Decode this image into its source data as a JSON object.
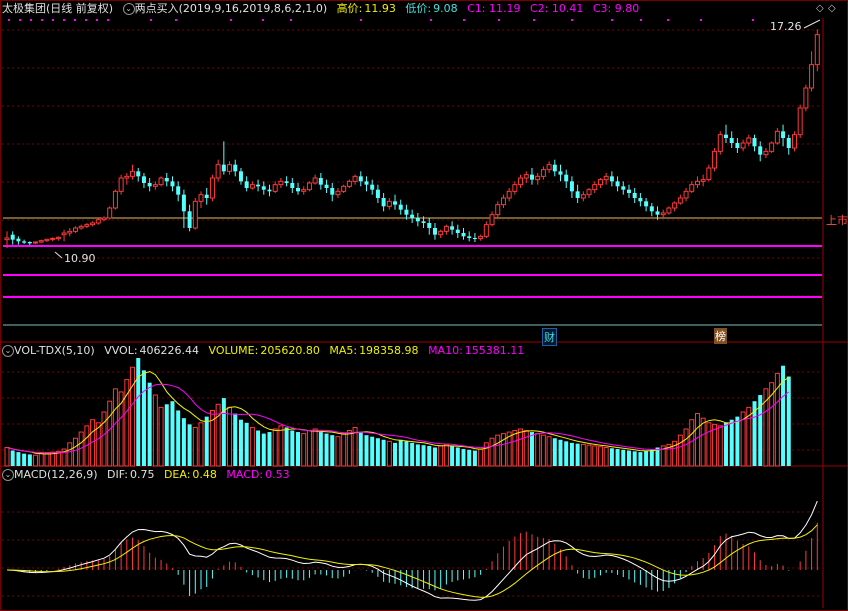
{
  "main": {
    "stock_name": "太极集团",
    "period_label": "(日线 前复权)",
    "indicator_name": "两点买入",
    "indicator_params": "(2019,9,16,2019,8,6,2,1,0)",
    "high_label": "高价:",
    "high_value": "11.93",
    "low_label": "低价:",
    "low_value": "9.08",
    "c1": "C1: 11.19",
    "c2": "C2: 10.41",
    "c3": "C3: 9.80",
    "max_price_label": "17.26",
    "min_price_label": "10.90",
    "right_edge_label": "上市",
    "event_tags": [
      "财",
      "榜"
    ]
  },
  "volume": {
    "name": "VOL-TDX(5,10)",
    "vvol_label": "VVOL:",
    "vvol_value": "406226.44",
    "volume_label": "VOLUME:",
    "volume_value": "205620.80",
    "ma5_label": "MA5:",
    "ma5_value": "198358.98",
    "ma10_label": "MA10:",
    "ma10_value": "155381.11"
  },
  "macd": {
    "name": "MACD(12,26,9)",
    "dif_label": "DIF:",
    "dif_value": "0.75",
    "dea_label": "DEA:",
    "dea_value": "0.48",
    "macd_label": "MACD:",
    "macd_value": "0.53"
  },
  "colors": {
    "up": "#ff3a3a",
    "down": "#54ffff",
    "grid": "#7a0000",
    "yellow": "#f0f000",
    "magenta": "#ff00ff",
    "white": "#ffffff"
  },
  "chart_data": {
    "type": "candlestick",
    "candles": [
      [
        10.95,
        11.2,
        11.0,
        10.7
      ],
      [
        11.1,
        11.2,
        10.95,
        10.8
      ],
      [
        10.98,
        11.05,
        10.9,
        10.8
      ],
      [
        10.9,
        10.95,
        10.86,
        10.82
      ],
      [
        10.88,
        10.9,
        10.84,
        10.78
      ],
      [
        10.86,
        10.9,
        10.88,
        10.82
      ],
      [
        10.88,
        10.95,
        10.92,
        10.85
      ],
      [
        10.92,
        10.98,
        10.96,
        10.88
      ],
      [
        10.96,
        11.02,
        10.99,
        10.9
      ],
      [
        10.98,
        11.05,
        11.02,
        10.92
      ],
      [
        11.1,
        11.25,
        11.15,
        10.9
      ],
      [
        11.15,
        11.3,
        11.2,
        11.05
      ],
      [
        11.2,
        11.35,
        11.3,
        11.15
      ],
      [
        11.3,
        11.4,
        11.35,
        11.25
      ],
      [
        11.35,
        11.45,
        11.4,
        11.3
      ],
      [
        11.4,
        11.5,
        11.45,
        11.35
      ],
      [
        11.45,
        11.6,
        11.55,
        11.4
      ],
      [
        11.55,
        11.65,
        11.6,
        11.5
      ],
      [
        11.6,
        11.95,
        11.9,
        11.55
      ],
      [
        11.9,
        12.45,
        12.4,
        11.85
      ],
      [
        12.4,
        12.9,
        12.8,
        12.3
      ],
      [
        12.8,
        12.95,
        12.85,
        12.6
      ],
      [
        12.85,
        13.2,
        13.0,
        12.75
      ],
      [
        13.0,
        13.1,
        12.85,
        12.7
      ],
      [
        12.85,
        12.95,
        12.65,
        12.5
      ],
      [
        12.65,
        12.8,
        12.55,
        12.4
      ],
      [
        12.55,
        12.7,
        12.6,
        12.45
      ],
      [
        12.6,
        12.85,
        12.8,
        12.55
      ],
      [
        12.8,
        12.95,
        12.7,
        12.55
      ],
      [
        12.7,
        12.85,
        12.55,
        12.4
      ],
      [
        12.55,
        12.7,
        12.3,
        12.1
      ],
      [
        12.3,
        12.45,
        11.8,
        11.3
      ],
      [
        11.8,
        12.0,
        11.3,
        11.2
      ],
      [
        11.3,
        12.2,
        12.1,
        11.25
      ],
      [
        12.1,
        12.4,
        12.3,
        11.9
      ],
      [
        12.3,
        12.5,
        12.2,
        12.0
      ],
      [
        12.2,
        12.9,
        12.8,
        12.1
      ],
      [
        12.8,
        13.35,
        13.2,
        12.7
      ],
      [
        13.2,
        13.9,
        13.0,
        12.9
      ],
      [
        13.0,
        13.3,
        13.2,
        12.9
      ],
      [
        13.2,
        13.35,
        13.0,
        12.85
      ],
      [
        13.0,
        13.1,
        12.7,
        12.6
      ],
      [
        12.7,
        12.85,
        12.5,
        12.4
      ],
      [
        12.5,
        12.7,
        12.6,
        12.45
      ],
      [
        12.6,
        12.75,
        12.55,
        12.4
      ],
      [
        12.55,
        12.7,
        12.45,
        12.3
      ],
      [
        12.45,
        12.6,
        12.4,
        12.25
      ],
      [
        12.4,
        12.7,
        12.6,
        12.35
      ],
      [
        12.6,
        12.8,
        12.7,
        12.5
      ],
      [
        12.7,
        12.85,
        12.65,
        12.55
      ],
      [
        12.65,
        12.8,
        12.5,
        12.35
      ],
      [
        12.5,
        12.65,
        12.4,
        12.3
      ],
      [
        12.4,
        12.55,
        12.45,
        12.3
      ],
      [
        12.45,
        12.7,
        12.65,
        12.4
      ],
      [
        12.65,
        12.9,
        12.8,
        12.6
      ],
      [
        12.8,
        12.95,
        12.6,
        12.45
      ],
      [
        12.6,
        12.75,
        12.5,
        12.35
      ],
      [
        12.5,
        12.65,
        12.3,
        12.1
      ],
      [
        12.3,
        12.5,
        12.4,
        12.2
      ],
      [
        12.4,
        12.6,
        12.55,
        12.35
      ],
      [
        12.55,
        12.75,
        12.7,
        12.5
      ],
      [
        12.7,
        12.9,
        12.85,
        12.6
      ],
      [
        12.85,
        13.0,
        12.7,
        12.55
      ],
      [
        12.7,
        12.85,
        12.6,
        12.4
      ],
      [
        12.6,
        12.75,
        12.45,
        12.3
      ],
      [
        12.45,
        12.6,
        12.2,
        12.05
      ],
      [
        12.2,
        12.35,
        11.95,
        11.8
      ],
      [
        11.95,
        12.2,
        12.1,
        11.85
      ],
      [
        12.1,
        12.3,
        12.0,
        11.85
      ],
      [
        12.0,
        12.15,
        11.85,
        11.7
      ],
      [
        11.85,
        12.0,
        11.7,
        11.55
      ],
      [
        11.7,
        11.85,
        11.6,
        11.45
      ],
      [
        11.6,
        11.75,
        11.5,
        11.35
      ],
      [
        11.5,
        11.65,
        11.45,
        11.3
      ],
      [
        11.45,
        11.6,
        11.3,
        11.1
      ],
      [
        11.3,
        11.45,
        11.1,
        10.95
      ],
      [
        11.1,
        11.25,
        11.2,
        11.0
      ],
      [
        11.2,
        11.4,
        11.35,
        11.1
      ],
      [
        11.35,
        11.5,
        11.25,
        11.1
      ],
      [
        11.25,
        11.4,
        11.15,
        11.0
      ],
      [
        11.15,
        11.3,
        11.05,
        10.95
      ],
      [
        11.05,
        11.2,
        11.0,
        10.9
      ],
      [
        11.0,
        11.15,
        10.98,
        10.88
      ],
      [
        10.98,
        11.1,
        11.05,
        10.92
      ],
      [
        11.05,
        11.5,
        11.4,
        11.0
      ],
      [
        11.4,
        11.8,
        11.7,
        11.35
      ],
      [
        11.7,
        12.1,
        12.0,
        11.6
      ],
      [
        12.0,
        12.3,
        12.2,
        11.9
      ],
      [
        12.2,
        12.5,
        12.4,
        12.1
      ],
      [
        12.4,
        12.7,
        12.6,
        12.3
      ],
      [
        12.6,
        12.9,
        12.8,
        12.5
      ],
      [
        12.8,
        13.0,
        12.9,
        12.65
      ],
      [
        12.9,
        13.1,
        12.75,
        12.6
      ],
      [
        12.75,
        12.95,
        12.85,
        12.6
      ],
      [
        12.85,
        13.15,
        13.05,
        12.75
      ],
      [
        13.05,
        13.3,
        13.2,
        12.95
      ],
      [
        13.2,
        13.35,
        13.0,
        12.85
      ],
      [
        13.0,
        13.2,
        12.9,
        12.7
      ],
      [
        12.9,
        13.05,
        12.7,
        12.5
      ],
      [
        12.7,
        12.85,
        12.4,
        12.2
      ],
      [
        12.4,
        12.6,
        12.2,
        12.05
      ],
      [
        12.2,
        12.4,
        12.3,
        12.1
      ],
      [
        12.3,
        12.5,
        12.45,
        12.2
      ],
      [
        12.45,
        12.7,
        12.6,
        12.35
      ],
      [
        12.6,
        12.8,
        12.75,
        12.5
      ],
      [
        12.75,
        12.95,
        12.85,
        12.6
      ],
      [
        12.85,
        13.0,
        12.7,
        12.55
      ],
      [
        12.7,
        12.85,
        12.55,
        12.4
      ],
      [
        12.55,
        12.7,
        12.45,
        12.3
      ],
      [
        12.45,
        12.6,
        12.35,
        12.2
      ],
      [
        12.35,
        12.5,
        12.2,
        12.05
      ],
      [
        12.2,
        12.35,
        12.1,
        11.95
      ],
      [
        12.1,
        12.2,
        11.95,
        11.8
      ],
      [
        11.95,
        12.05,
        11.8,
        11.65
      ],
      [
        11.8,
        11.95,
        11.7,
        11.55
      ],
      [
        11.7,
        11.85,
        11.75,
        11.6
      ],
      [
        11.75,
        11.95,
        11.9,
        11.7
      ],
      [
        11.9,
        12.1,
        12.05,
        11.8
      ],
      [
        12.05,
        12.3,
        12.2,
        12.0
      ],
      [
        12.2,
        12.5,
        12.4,
        12.1
      ],
      [
        12.4,
        12.7,
        12.6,
        12.35
      ],
      [
        12.6,
        12.85,
        12.7,
        12.5
      ],
      [
        12.7,
        12.9,
        12.75,
        12.55
      ],
      [
        12.75,
        13.2,
        13.1,
        12.7
      ],
      [
        13.1,
        13.7,
        13.6,
        13.0
      ],
      [
        13.6,
        14.2,
        14.1,
        13.5
      ],
      [
        14.1,
        14.4,
        14.0,
        13.85
      ],
      [
        14.0,
        14.2,
        13.85,
        13.7
      ],
      [
        13.85,
        14.0,
        13.7,
        13.55
      ],
      [
        13.7,
        13.95,
        13.85,
        13.6
      ],
      [
        13.85,
        14.1,
        14.0,
        13.75
      ],
      [
        14.0,
        14.1,
        13.75,
        13.6
      ],
      [
        13.75,
        13.9,
        13.5,
        13.3
      ],
      [
        13.5,
        13.7,
        13.6,
        13.4
      ],
      [
        13.6,
        13.9,
        13.85,
        13.55
      ],
      [
        13.85,
        14.3,
        14.2,
        13.8
      ],
      [
        14.2,
        14.4,
        14.0,
        13.75
      ],
      [
        14.0,
        14.1,
        13.7,
        13.5
      ],
      [
        13.7,
        14.2,
        14.1,
        13.6
      ],
      [
        14.1,
        15.0,
        14.9,
        14.0
      ],
      [
        14.9,
        15.6,
        15.5,
        14.8
      ],
      [
        15.5,
        16.6,
        16.2,
        15.4
      ],
      [
        16.2,
        17.26,
        17.1,
        16.0
      ]
    ],
    "volumes": [
      120,
      100,
      90,
      80,
      75,
      70,
      85,
      80,
      90,
      95,
      110,
      150,
      180,
      220,
      260,
      300,
      280,
      350,
      420,
      500,
      480,
      560,
      640,
      700,
      620,
      540,
      460,
      380,
      400,
      420,
      360,
      310,
      270,
      250,
      280,
      320,
      360,
      400,
      440,
      380,
      340,
      300,
      280,
      250,
      230,
      210,
      220,
      240,
      260,
      250,
      230,
      220,
      210,
      230,
      240,
      220,
      210,
      200,
      190,
      210,
      230,
      250,
      220,
      200,
      190,
      180,
      170,
      160,
      150,
      170,
      160,
      150,
      140,
      135,
      130,
      120,
      130,
      140,
      130,
      120,
      110,
      105,
      100,
      110,
      150,
      180,
      200,
      210,
      220,
      230,
      240,
      230,
      220,
      210,
      200,
      190,
      180,
      170,
      160,
      150,
      145,
      140,
      135,
      130,
      125,
      120,
      115,
      110,
      105,
      100,
      95,
      90,
      100,
      110,
      120,
      130,
      140,
      160,
      200,
      240,
      300,
      340,
      310,
      280,
      270,
      260,
      280,
      300,
      320,
      350,
      380,
      420,
      460,
      500,
      540,
      600,
      650,
      580
    ],
    "ylim_price": [
      10.4,
      17.6
    ]
  }
}
